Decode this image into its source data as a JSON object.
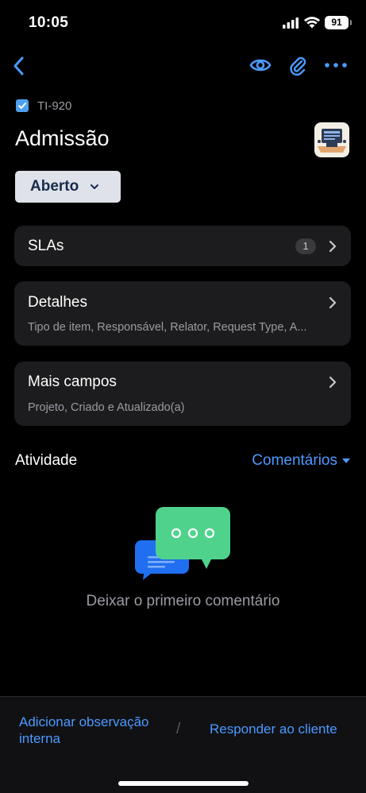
{
  "status_bar": {
    "time": "10:05",
    "battery": "91"
  },
  "nav": {
    "back_icon": "chevron-left-icon",
    "watch_icon": "eye-icon",
    "attach_icon": "paperclip-icon",
    "more_icon": "more-horizontal-icon"
  },
  "issue": {
    "key": "TI-920",
    "title": "Admissão",
    "type_icon": "service-request-icon",
    "status": "Aberto"
  },
  "cards": {
    "slas": {
      "title": "SLAs",
      "count": "1"
    },
    "details": {
      "title": "Detalhes",
      "subtitle": "Tipo de item, Responsável, Relator, Request Type, A..."
    },
    "more_fields": {
      "title": "Mais campos",
      "subtitle": "Projeto, Criado e Atualizado(a)"
    }
  },
  "activity": {
    "label": "Atividade",
    "filter": "Comentários",
    "empty_text": "Deixar o primeiro comentário"
  },
  "bottom": {
    "add_note": "Adicionar observação interna",
    "separator": "/",
    "reply": "Responder ao cliente"
  },
  "colors": {
    "accent": "#4c9aff",
    "card_bg": "#1c1c1e",
    "status_btn_bg": "#dfe2e8",
    "bubble_green": "#4fd38c",
    "bubble_blue": "#1f6ff0"
  }
}
